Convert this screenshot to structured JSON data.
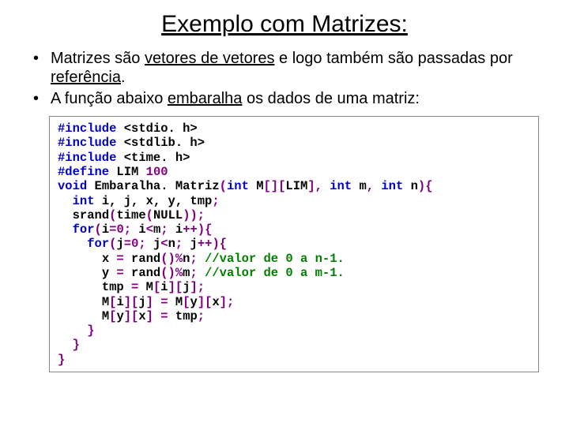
{
  "title": "Exemplo com Matrizes:",
  "bullets": {
    "b1_pre": "Matrizes são ",
    "b1_u": "vetores de vetores",
    "b1_mid": " e logo também são passadas por ",
    "b1_u2": "referência",
    "b1_end": ".",
    "b2_pre": "A função abaixo ",
    "b2_u": "embaralha",
    "b2_end": " os dados de uma matriz:"
  },
  "code": {
    "l01_kw": "#include ",
    "l01_lib": "<stdio. h>",
    "l02_kw": "#include ",
    "l02_lib": "<stdlib. h>",
    "l03_kw": "#include ",
    "l03_lib": "<time. h>",
    "l04_kw": "#define ",
    "l04_id": "LIM ",
    "l04_num": "100",
    "l05_kw": "void ",
    "l05_fn": "Embaralha. Matriz",
    "l05_p1": "(",
    "l05_kw2": "int ",
    "l05_p2": "M",
    "l05_br1": "[][",
    "l05_lim": "LIM",
    "l05_br2": "], ",
    "l05_kw3": "int ",
    "l05_p3": "m",
    "l05_c1": ", ",
    "l05_kw4": "int ",
    "l05_p4": "n",
    "l05_end": "){",
    "l06_pre": "  ",
    "l06_kw": "int ",
    "l06_rest": "i, j, x, y, tmp",
    "l06_sc": ";",
    "l07_pre": "  ",
    "l07_a": "srand",
    "l07_b": "(",
    "l07_c": "time",
    "l07_d": "(",
    "l07_e": "NULL",
    "l07_f": "));",
    "l08_pre": "  ",
    "l08_kw": "for",
    "l08_a": "(",
    "l08_b": "i",
    "l08_eq": "=",
    "l08_n0": "0",
    "l08_sc1": ";",
    "l08_c": " i",
    "l08_lt": "<",
    "l08_d": "m",
    "l08_sc2": ";",
    "l08_e": " i",
    "l08_pp": "++){",
    "l09_pre": "    ",
    "l09_kw": "for",
    "l09_a": "(",
    "l09_b": "j",
    "l09_eq": "=",
    "l09_n0": "0",
    "l09_sc1": ";",
    "l09_c": " j",
    "l09_lt": "<",
    "l09_d": "n",
    "l09_sc2": ";",
    "l09_e": " j",
    "l09_pp": "++){",
    "l10_pre": "      ",
    "l10_a": "x ",
    "l10_eq": "= ",
    "l10_b": "rand",
    "l10_c": "()%",
    "l10_d": "n",
    "l10_sc": "; ",
    "l10_cmt": "//valor de 0 a n-1.",
    "l11_pre": "      ",
    "l11_a": "y ",
    "l11_eq": "= ",
    "l11_b": "rand",
    "l11_c": "()%",
    "l11_d": "m",
    "l11_sc": "; ",
    "l11_cmt": "//valor de 0 a m-1.",
    "l12_pre": "      ",
    "l12_a": "tmp ",
    "l12_eq": "= ",
    "l12_b": "M",
    "l12_c": "[",
    "l12_d": "i",
    "l12_e": "][",
    "l12_f": "j",
    "l12_g": "];",
    "l13_pre": "      ",
    "l13_a": "M",
    "l13_b": "[",
    "l13_c": "i",
    "l13_d": "][",
    "l13_e": "j",
    "l13_f": "] ",
    "l13_eq": "= ",
    "l13_g": "M",
    "l13_h": "[",
    "l13_i": "y",
    "l13_j": "][",
    "l13_k": "x",
    "l13_l": "];",
    "l14_pre": "      ",
    "l14_a": "M",
    "l14_b": "[",
    "l14_c": "y",
    "l14_d": "][",
    "l14_e": "x",
    "l14_f": "] ",
    "l14_eq": "= ",
    "l14_g": "tmp",
    "l14_sc": ";",
    "l15": "    }",
    "l16": "  }",
    "l17": "}"
  }
}
